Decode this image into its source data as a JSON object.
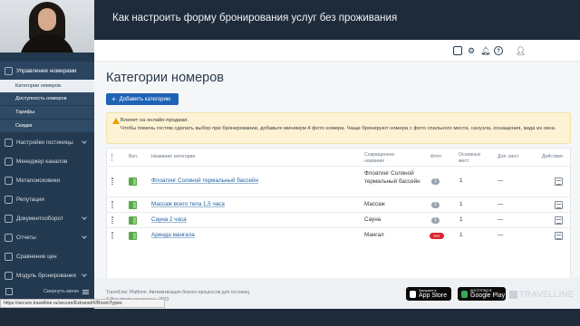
{
  "video": {
    "title": "Как настроить форму бронирования услуг без проживания"
  },
  "sidebar": {
    "items": [
      {
        "label": "Управление номерами",
        "icon": "rooms-icon"
      },
      {
        "label": "Настройки гостиницы",
        "icon": "hotel-settings-icon"
      },
      {
        "label": "Менеджер каналов",
        "icon": "channels-icon"
      },
      {
        "label": "Метапоисковики",
        "icon": "metasearch-icon"
      },
      {
        "label": "Репутация",
        "icon": "reputation-icon"
      },
      {
        "label": "Документооборот",
        "icon": "documents-icon"
      },
      {
        "label": "Отчеты",
        "icon": "reports-icon"
      },
      {
        "label": "Сравнение цен",
        "icon": "price-compare-icon"
      },
      {
        "label": "Модуль бронирования",
        "icon": "booking-module-icon"
      }
    ],
    "subitems": [
      {
        "label": "Категории номеров"
      },
      {
        "label": "Доступность номеров"
      },
      {
        "label": "Тарифы"
      },
      {
        "label": "Скидки"
      }
    ],
    "collapse_label": "Свернуть меню"
  },
  "status_url": "https://secure.travelline.ru/secure/Extranet/#/RoomTypes",
  "page": {
    "title": "Категории номеров",
    "add_button": "Добавить категорию"
  },
  "warning": {
    "title": "Влияет на онлайн-продажи.",
    "text": "Чтобы помочь гостям сделать выбор при бронировании, добавьте минимум 4 фото номера. Чаще бронируют номера с фото спального места, санузла, оснащения, вида из окна."
  },
  "table": {
    "headers": {
      "enabled": "Вкл.",
      "name": "Название категории",
      "short_name": "Сокращенное название",
      "photo": "Фото",
      "main_places": "Основных мест",
      "extra_places": "Доп. мест",
      "actions": "Действия"
    },
    "rows": [
      {
        "name": "Флоатинг Соляной термальный бассейн",
        "short_name": "Флоатинг Соляной термальный бассейн",
        "photo": "1",
        "main_places": "1",
        "extra_places": "—"
      },
      {
        "name": "Массаж всего тела 1,5 часа",
        "short_name": "Массаж",
        "photo": "1",
        "main_places": "1",
        "extra_places": "—"
      },
      {
        "name": "Сауна 2 часа",
        "short_name": "Сауна",
        "photo": "1",
        "main_places": "1",
        "extra_places": "—"
      },
      {
        "name": "Аренда мангала",
        "short_name": "Мангал",
        "photo": "Нет",
        "main_places": "1",
        "extra_places": "—"
      }
    ]
  },
  "footer": {
    "line1": "TravelLine: Platform. Автоматизация бизнес-процессов для гостиниц.",
    "line2": "© Все права защищены, 2023",
    "appstore_small": "Загрузите в",
    "appstore_big": "App Store",
    "googleplay_small": "ДОСТУПНО В",
    "googleplay_big": "Google Play",
    "brand": "TRAVELLINE"
  },
  "colors": {
    "sidebar": "#23394f",
    "primary_button": "#1f63b5",
    "warning_bg": "#fdf3d4",
    "toggle_on": "#5aa84a",
    "no_photo_badge": "#d9262e"
  }
}
